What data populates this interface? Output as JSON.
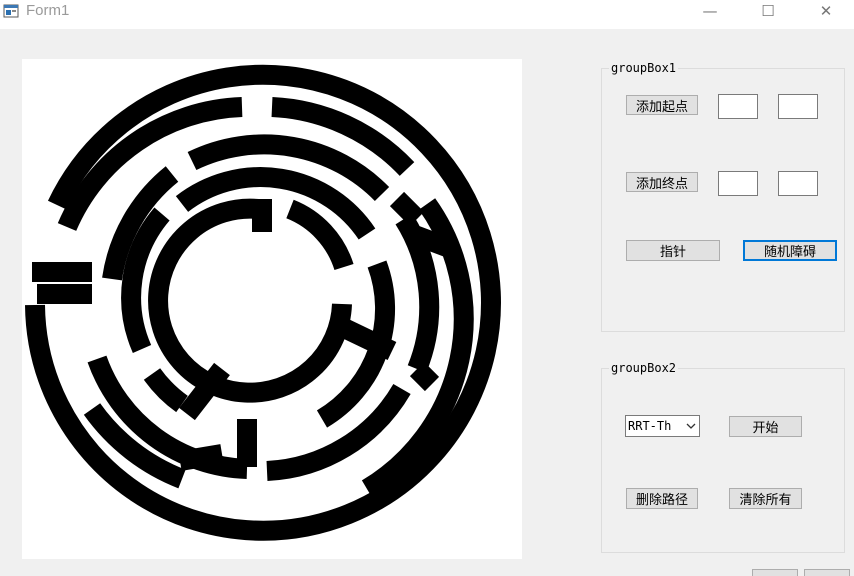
{
  "window": {
    "title": "Form1"
  },
  "title_buttons": {
    "minimize": "—",
    "maximize": "☐",
    "close": "✕"
  },
  "groupBox1": {
    "title": "groupBox1",
    "add_start_label": "添加起点",
    "add_end_label": "添加终点",
    "start_x": "",
    "start_y": "",
    "end_x": "",
    "end_y": "",
    "pointer_label": "指针",
    "random_obstacle_label": "随机障碍"
  },
  "groupBox2": {
    "title": "groupBox2",
    "algorithm_selected": "RRT-Th",
    "start_label": "开始",
    "delete_path_label": "删除路径",
    "clear_all_label": "清除所有"
  }
}
